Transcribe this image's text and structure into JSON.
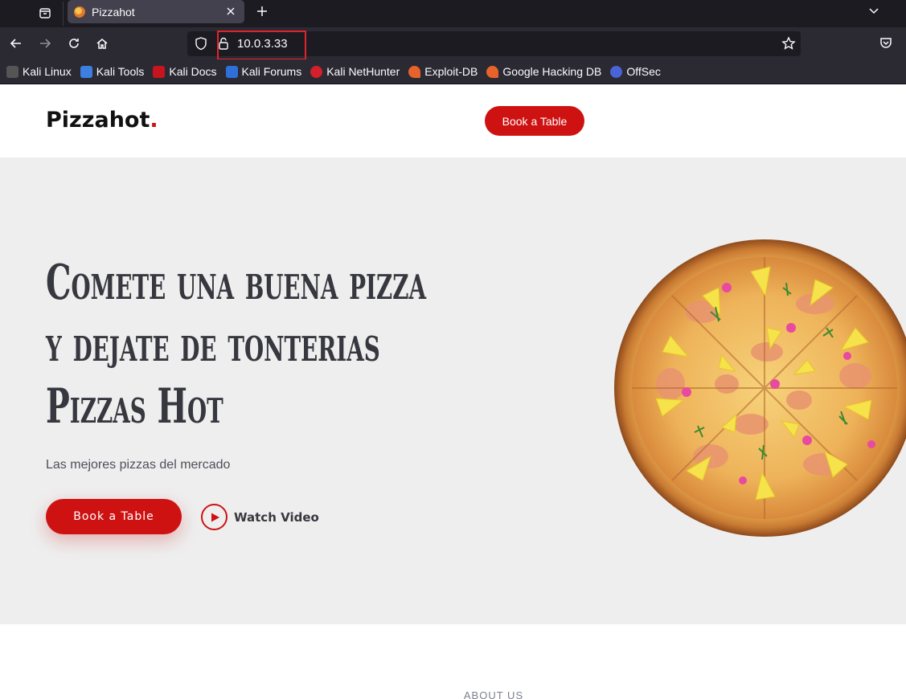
{
  "browser": {
    "tab_title": "Pizzahot",
    "url": "10.0.3.33",
    "bookmarks": [
      {
        "label": "Kali Linux",
        "color": "#3b3b3b"
      },
      {
        "label": "Kali Tools",
        "color": "#3c7fe0"
      },
      {
        "label": "Kali Docs",
        "color": "#c8141e"
      },
      {
        "label": "Kali Forums",
        "color": "#2e6fd9"
      },
      {
        "label": "Kali NetHunter",
        "color": "#d3202a"
      },
      {
        "label": "Exploit-DB",
        "color": "#e8632b"
      },
      {
        "label": "Google Hacking DB",
        "color": "#e8632b"
      },
      {
        "label": "OffSec",
        "color": "#4a63d8"
      }
    ]
  },
  "site": {
    "logo_text": "Pizzahot",
    "logo_dot": ".",
    "header_cta": "Book a Table",
    "accent_color": "#ce1212"
  },
  "hero": {
    "title_lines": [
      "Comete una buena pizza",
      "y dejate de tonterias",
      "Pizzas Hot"
    ],
    "subtitle": "Las mejores pizzas del mercado",
    "cta": "Book a Table",
    "watch_video": "Watch Video"
  },
  "about": {
    "section_label": "ABOUT US"
  }
}
